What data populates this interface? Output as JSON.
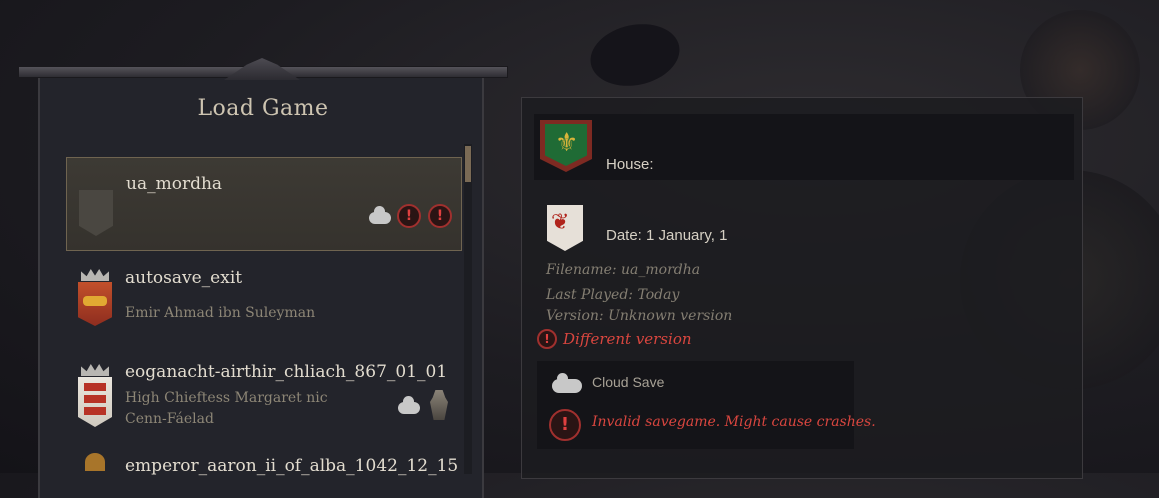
{
  "panel": {
    "title": "Load Game"
  },
  "saves": [
    {
      "name": "ua_mordha",
      "subtitle": "",
      "selected": true,
      "icons": [
        "cloud-icon",
        "warning-icon",
        "warning-icon"
      ]
    },
    {
      "name": "autosave_exit",
      "subtitle": "Emir Ahmad ibn Suleyman",
      "selected": false,
      "icons": []
    },
    {
      "name": "eoganacht-airthir_chliach_867_01_01",
      "subtitle_line1": "High Chieftess Margaret nic",
      "subtitle_line2": "Cenn-Fáelad",
      "selected": false,
      "icons": [
        "cloud-icon",
        "knight-icon"
      ]
    },
    {
      "name": "emperor_aaron_ii_of_alba_1042_12_15",
      "selected": false
    }
  ],
  "details": {
    "house_label": "House:",
    "date_label": "Date: 1 January, 1",
    "filename": "Filename: ua_mordha",
    "last_played": "Last Played: Today",
    "version": "Version: Unknown version",
    "version_warning": "Different version",
    "cloud_label": "Cloud Save",
    "invalid_warning": "Invalid savegame. Might cause crashes."
  },
  "colors": {
    "warning": "#d9463f",
    "accent": "#6f6450",
    "house_green": "#1f6b35",
    "fleur_gold": "#d9b43a"
  }
}
